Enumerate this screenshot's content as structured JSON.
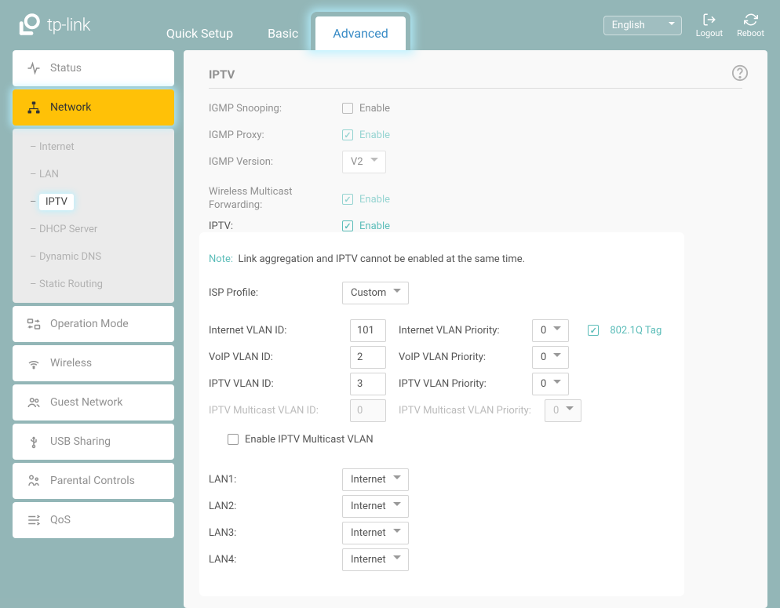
{
  "brand": "tp-link",
  "tabs": {
    "quick": "Quick Setup",
    "basic": "Basic",
    "advanced": "Advanced"
  },
  "header": {
    "language": "English",
    "logout": "Logout",
    "reboot": "Reboot"
  },
  "sidebar": {
    "status": "Status",
    "network": "Network",
    "network_items": [
      "Internet",
      "LAN",
      "IPTV",
      "DHCP Server",
      "Dynamic DNS",
      "Static Routing"
    ],
    "operation_mode": "Operation Mode",
    "wireless": "Wireless",
    "guest_network": "Guest Network",
    "usb_sharing": "USB Sharing",
    "parental": "Parental Controls",
    "qos": "QoS"
  },
  "iptv": {
    "title": "IPTV",
    "igmp_snooping": "IGMP Snooping:",
    "igmp_proxy": "IGMP Proxy:",
    "igmp_version": "IGMP Version:",
    "igmp_version_val": "V2",
    "wmf": "Wireless Multicast Forwarding:",
    "iptv_lbl": "IPTV:",
    "enable": "Enable",
    "note_label": "Note:",
    "note_text": "Link aggregation and IPTV cannot be enabled at the same time.",
    "isp_profile": "ISP Profile:",
    "isp_profile_val": "Custom",
    "internet_vlan_id": "Internet VLAN ID:",
    "internet_vlan_id_val": "101",
    "internet_vlan_pri": "Internet VLAN Priority:",
    "internet_vlan_pri_val": "0",
    "tag": "802.1Q Tag",
    "voip_vlan_id": "VoIP VLAN ID:",
    "voip_vlan_id_val": "2",
    "voip_vlan_pri": "VoIP VLAN Priority:",
    "voip_vlan_pri_val": "0",
    "iptv_vlan_id": "IPTV VLAN ID:",
    "iptv_vlan_id_val": "3",
    "iptv_vlan_pri": "IPTV VLAN Priority:",
    "iptv_vlan_pri_val": "0",
    "mcast_vlan_id": "IPTV Multicast VLAN ID:",
    "mcast_vlan_id_val": "0",
    "mcast_vlan_pri": "IPTV Multicast VLAN Priority:",
    "mcast_vlan_pri_val": "0",
    "enable_mcast": "Enable IPTV Multicast VLAN",
    "lan1": "LAN1:",
    "lan2": "LAN2:",
    "lan3": "LAN3:",
    "lan4": "LAN4:",
    "lan_val": "Internet"
  }
}
